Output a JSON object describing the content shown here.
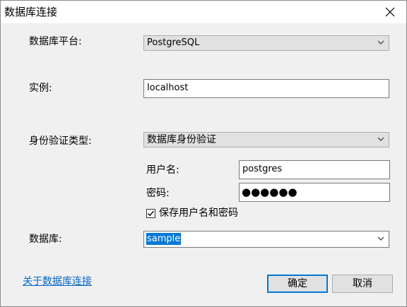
{
  "window": {
    "title": "数据库连接",
    "close_icon": "close-icon"
  },
  "form": {
    "platform_label": "数据库平台:",
    "platform_value": "PostgreSQL",
    "instance_label": "实例:",
    "instance_value": "localhost",
    "auth_type_label": "身份验证类型:",
    "auth_type_value": "数据库身份验证",
    "username_label": "用户名:",
    "username_value": "postgres",
    "password_label": "密码:",
    "password_mask": "●●●●●●",
    "save_credentials_label": "保存用户名和密码",
    "save_credentials_checked": true,
    "database_label": "数据库:",
    "database_value": "sample"
  },
  "footer": {
    "about_link": "关于数据库连接",
    "ok_label": "确定",
    "cancel_label": "取消"
  },
  "colors": {
    "accent": "#0078d7",
    "link": "#0066cc",
    "dialog_bg": "#f0f0f0"
  }
}
